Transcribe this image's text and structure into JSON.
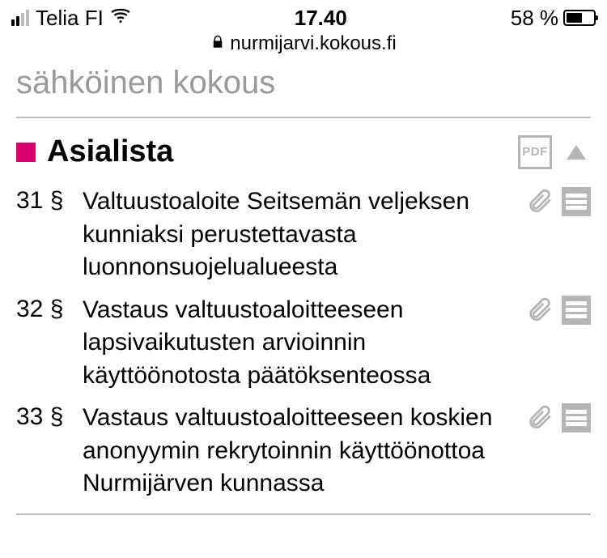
{
  "status_bar": {
    "carrier": "Telia FI",
    "time": "17.40",
    "battery_pct": "58 %",
    "battery_fill_pct": 58
  },
  "url_bar": {
    "domain": "nurmijarvi.kokous.fi"
  },
  "page": {
    "partial_title": "sähköinen kokous"
  },
  "section": {
    "title": "Asialista",
    "pdf_label": "PDF"
  },
  "agenda": [
    {
      "num": "31 §",
      "title": "Valtuustoaloite Seitsemän veljeksen kunniaksi perustettavasta luonnonsuojelualueesta"
    },
    {
      "num": "32 §",
      "title": "Vastaus valtuustoaloitteeseen lapsivaikutusten arvioinnin käyttöönotosta päätöksenteossa"
    },
    {
      "num": "33 §",
      "title": "Vastaus valtuustoaloitteeseen koskien anonyymin rekrytoinnin käyttöönottoa Nurmijärven kunnassa"
    }
  ]
}
